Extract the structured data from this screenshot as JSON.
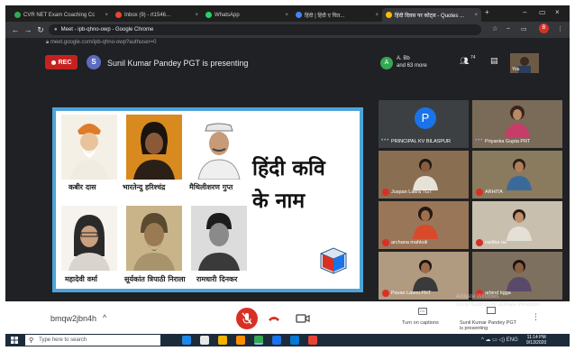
{
  "browser": {
    "tabs": [
      {
        "label": "CVR NET Exam Coaching Cc",
        "favicon_color": "#34a853"
      },
      {
        "label": "Inbox (9) - rt1546...",
        "favicon_color": "#ea4335"
      },
      {
        "label": "WhatsApp",
        "favicon_color": "#25d366"
      },
      {
        "label": "हिंदी | हिंदी ए चित...",
        "favicon_color": "#4285f4"
      },
      {
        "label": "हिंदी दिवस पर कोट्स - Quotes ...",
        "favicon_color": "#fbbc04"
      },
      {
        "label": "Meet - ipb-qhno-owp - Google Chrome",
        "favicon_color": "#00897b"
      }
    ],
    "new_tab": "+",
    "window_title": "Meet - ipb-qhno-owp - Google Chrome",
    "url": "meet.google.com/ipb-qhno-owp?authuser=0",
    "profile_initial": "B"
  },
  "meet": {
    "rec_label": "REC",
    "presenter_initial": "S",
    "presenting_text": "Sunil Kumar Pandey PGT is presenting",
    "participants_initial": "A",
    "participants_line1": "A. Bb",
    "participants_line2": "and 63 more",
    "people_count": "74",
    "self_label": "You",
    "slide": {
      "title_line1": "हिंदी कवि",
      "title_line2": "के नाम",
      "poets": [
        "कबीर दास",
        "भारतेन्दु हरिश्चंद्र",
        "मैथिलीशरण गुप्त",
        "महादेवी वर्मा",
        "सूर्यकांत त्रिपाठी निराला",
        "रामधारी दिनकर"
      ]
    },
    "tiles": [
      {
        "name": "PRINCIPAL KV BILASPUR",
        "initial": "P"
      },
      {
        "name": "Priyanka Gupta PRT"
      },
      {
        "name": "Juspan Lakra TGT"
      },
      {
        "name": "ARHITA"
      },
      {
        "name": "archana mahkoli"
      },
      {
        "name": "vartika rai"
      },
      {
        "name": "Pavan Laxmi PRT"
      },
      {
        "name": "arbind tigga"
      }
    ],
    "meeting_code": "bmqw2jbn4h",
    "captions_label": "Turn on captions",
    "present_label": "Sunil Kumar Pandey PGT",
    "present_sub": "is presenting",
    "activate_line1": "Activate Windows",
    "activate_line2": "Go to Settings to activate Windows."
  },
  "taskbar": {
    "search_placeholder": "Type here to search",
    "tray": "^ ☁ ▭ ◁) ENG",
    "time": "11:14 PM",
    "date": "9/13/2020"
  }
}
